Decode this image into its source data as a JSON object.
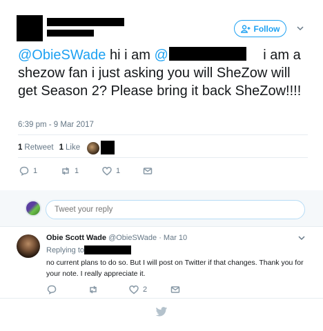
{
  "header": {
    "follow_label": "Follow",
    "icons": [
      "person-add-icon",
      "chevron-down-icon"
    ]
  },
  "tweet": {
    "mention": "@ObieSWade",
    "text_part1": " hi i am ",
    "mention2": "@",
    "text_part2": " i am a shezow fan i just asking you will SheZow will get Season 2? Please bring it back SheZow!!!!",
    "timestamp": "6:39 pm - 9 Mar 2017",
    "retweets_count": "1",
    "retweets_label": "Retweet",
    "likes_count": "1",
    "likes_label": "Like"
  },
  "actions": {
    "reply_count": "1",
    "retweet_count": "1",
    "like_count": "1"
  },
  "reply_box": {
    "placeholder": "Tweet your reply"
  },
  "reply": {
    "name": "Obie Scott Wade",
    "handle": "@ObieSWade",
    "separator": " · ",
    "date": "Mar 10",
    "replying_to": "Replying to",
    "text": "no current plans to do so.  But I will post on Twitter if that changes. Thank you for your note. I really appreciate it.",
    "reply_count": "",
    "retweet_count": "",
    "like_count": "2"
  },
  "colors": {
    "accent": "#1da1f2",
    "muted": "#657786",
    "divider": "#e6ecf0"
  }
}
